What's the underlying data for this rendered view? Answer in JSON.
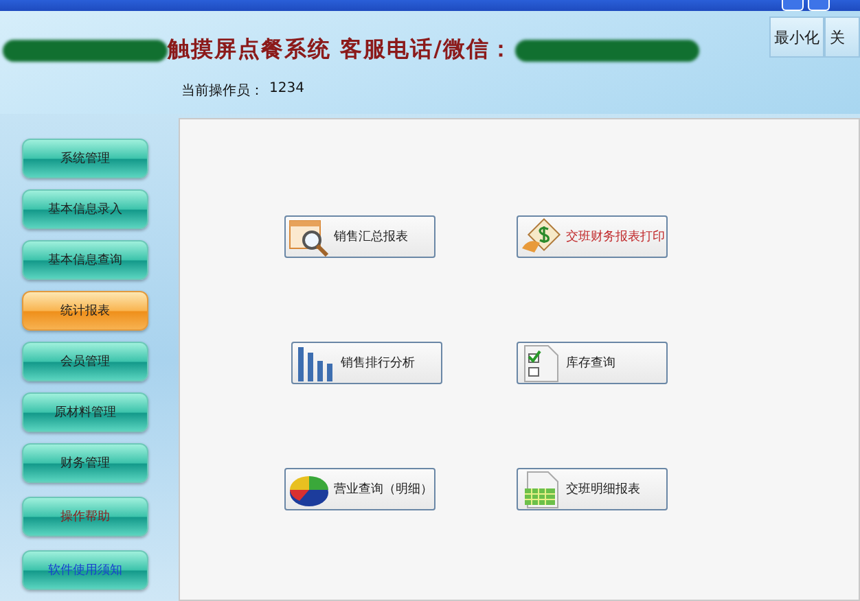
{
  "header": {
    "title": "触摸屏点餐系统  客服电话/微信：",
    "operator_label": "当前操作员：",
    "operator_value": "1234",
    "buttons": [
      "最小化",
      "关"
    ]
  },
  "sidebar": {
    "items": [
      {
        "label": "系统管理",
        "selected": false,
        "kind": "normal"
      },
      {
        "label": "基本信息录入",
        "selected": false,
        "kind": "normal"
      },
      {
        "label": "基本信息查询",
        "selected": false,
        "kind": "normal"
      },
      {
        "label": "统计报表",
        "selected": true,
        "kind": "normal"
      },
      {
        "label": "会员管理",
        "selected": false,
        "kind": "normal"
      },
      {
        "label": "原材料管理",
        "selected": false,
        "kind": "normal"
      },
      {
        "label": "财务管理",
        "selected": false,
        "kind": "normal"
      },
      {
        "label": "操作帮助",
        "selected": false,
        "kind": "help"
      },
      {
        "label": "软件使用须知",
        "selected": false,
        "kind": "notice"
      }
    ]
  },
  "reports": [
    {
      "label": "销售汇总报表",
      "kind": "magnifier",
      "emphasized": false
    },
    {
      "label": "交班财务报表打印",
      "kind": "money",
      "emphasized": true
    },
    {
      "label": "销售排行分析",
      "kind": "bars",
      "emphasized": false
    },
    {
      "label": "库存查询",
      "kind": "checklist",
      "emphasized": false
    },
    {
      "label": "营业查询（明细）",
      "kind": "pie",
      "emphasized": false
    },
    {
      "label": "交班明细报表",
      "kind": "sheet",
      "emphasized": false
    }
  ]
}
